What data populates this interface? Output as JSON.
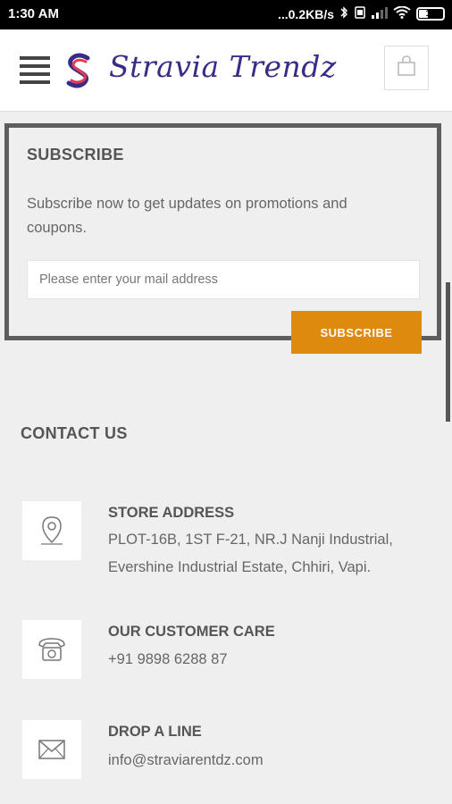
{
  "status_bar": {
    "time": "1:30 AM",
    "network_speed": "...0.2KB/s",
    "battery_level": "19"
  },
  "header": {
    "brand": "Stravia Trendz"
  },
  "subscribe": {
    "title": "SUBSCRIBE",
    "description": "Subscribe now to get updates on promotions and coupons.",
    "email_placeholder": "Please enter your mail address",
    "button_label": "SUBSCRIBE"
  },
  "contact": {
    "title": "CONTACT US",
    "store": {
      "heading": "STORE ADDRESS",
      "line1": "PLOT-16B, 1ST F-21, NR.J Nanji Industrial,",
      "line2": "Evershine Industrial Estate, Chhiri, Vapi."
    },
    "care": {
      "heading": "OUR CUSTOMER CARE",
      "phone": "+91 9898 6288 87"
    },
    "mail": {
      "heading": "DROP A LINE",
      "email": "info@straviarentdz.com"
    }
  },
  "colors": {
    "accent": "#de8a0e",
    "brand": "#3b2a86",
    "border": "#5e5e5e"
  }
}
